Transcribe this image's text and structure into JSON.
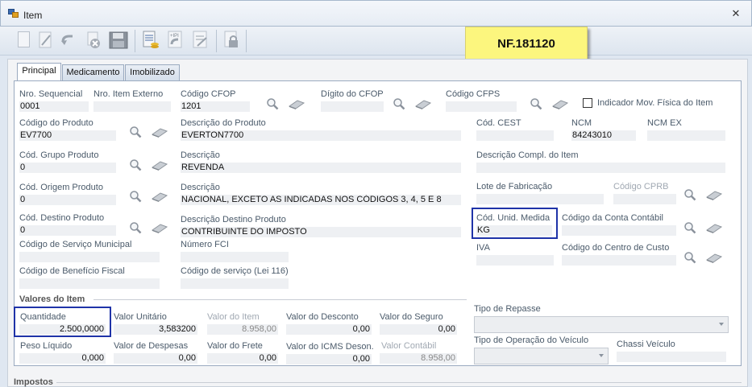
{
  "window": {
    "title": "Item"
  },
  "badge": "NF.181120",
  "tabs": [
    "Principal",
    "Medicamento",
    "Imobilizado"
  ],
  "fields": {
    "nro_sequencial": {
      "label": "Nro. Sequencial",
      "value": "0001"
    },
    "nro_item_externo": {
      "label": "Nro. Item Externo",
      "value": ""
    },
    "codigo_cfop": {
      "label": "Código CFOP",
      "value": "1201"
    },
    "digito_cfop": {
      "label": "Dígito do CFOP",
      "value": ""
    },
    "codigo_cfps": {
      "label": "Código CFPS",
      "value": ""
    },
    "indicador_mov": {
      "label": "Indicador Mov. Física do Item"
    },
    "codigo_produto": {
      "label": "Código do Produto",
      "value": "EV7700"
    },
    "descricao_produto": {
      "label": "Descrição do Produto",
      "value": "EVERTON7700"
    },
    "cod_cest": {
      "label": "Cód. CEST",
      "value": ""
    },
    "ncm": {
      "label": "NCM",
      "value": "84243010"
    },
    "ncm_ex": {
      "label": "NCM EX",
      "value": ""
    },
    "cod_grupo_produto": {
      "label": "Cód. Grupo Produto",
      "value": "0"
    },
    "descricao_grupo": {
      "label": "Descrição",
      "value": "REVENDA"
    },
    "descricao_compl": {
      "label": "Descrição Compl. do Item",
      "value": ""
    },
    "cod_origem_produto": {
      "label": "Cód. Origem Produto",
      "value": "0"
    },
    "descricao_origem": {
      "label": "Descrição",
      "value": "NACIONAL, EXCETO AS INDICADAS NOS CÓDIGOS 3, 4, 5 E 8"
    },
    "lote_fabricacao": {
      "label": "Lote de Fabricação",
      "value": ""
    },
    "codigo_cprb": {
      "label": "Código CPRB",
      "value": ""
    },
    "cod_destino_produto": {
      "label": "Cód. Destino Produto",
      "value": "0"
    },
    "descricao_destino": {
      "label": "Descrição Destino Produto",
      "value": "CONTRIBUINTE DO IMPOSTO"
    },
    "cod_unid_medida": {
      "label": "Cód. Unid. Medida",
      "value": "KG"
    },
    "codigo_conta_contabil": {
      "label": "Código da Conta Contábil",
      "value": ""
    },
    "codigo_servico_municipal": {
      "label": "Código de Serviço Municipal",
      "value": ""
    },
    "numero_fci": {
      "label": "Número FCI",
      "value": ""
    },
    "iva": {
      "label": "IVA",
      "value": ""
    },
    "codigo_centro_custo": {
      "label": "Código do Centro de Custo",
      "value": ""
    },
    "codigo_beneficio_fiscal": {
      "label": "Código de Benefício Fiscal",
      "value": ""
    },
    "codigo_servico_lei": {
      "label": "Código de serviço (Lei 116)",
      "value": ""
    }
  },
  "valores": {
    "title": "Valores do Item",
    "quantidade": {
      "label": "Quantidade",
      "value": "2.500,0000"
    },
    "valor_unitario": {
      "label": "Valor Unitário",
      "value": "3,583200"
    },
    "valor_item": {
      "label": "Valor do Item",
      "value": "8.958,00"
    },
    "valor_desconto": {
      "label": "Valor do Desconto",
      "value": "0,00"
    },
    "valor_seguro": {
      "label": "Valor do Seguro",
      "value": "0,00"
    },
    "tipo_repasse": {
      "label": "Tipo de Repasse",
      "value": ""
    },
    "peso_liquido": {
      "label": "Peso Líquido",
      "value": "0,000"
    },
    "valor_despesas": {
      "label": "Valor de Despesas",
      "value": "0,00"
    },
    "valor_frete": {
      "label": "Valor do  Frete",
      "value": "0,00"
    },
    "valor_icms_deson": {
      "label": "Valor do ICMS Deson.",
      "value": "0,00"
    },
    "valor_contabil": {
      "label": "Valor Contábil",
      "value": "8.958,00"
    },
    "tipo_operacao_veiculo": {
      "label": "Tipo de Operação do Veículo",
      "value": ""
    },
    "chassi_veiculo": {
      "label": "Chassi Veículo",
      "value": ""
    }
  },
  "impostos": {
    "title": "Impostos"
  }
}
